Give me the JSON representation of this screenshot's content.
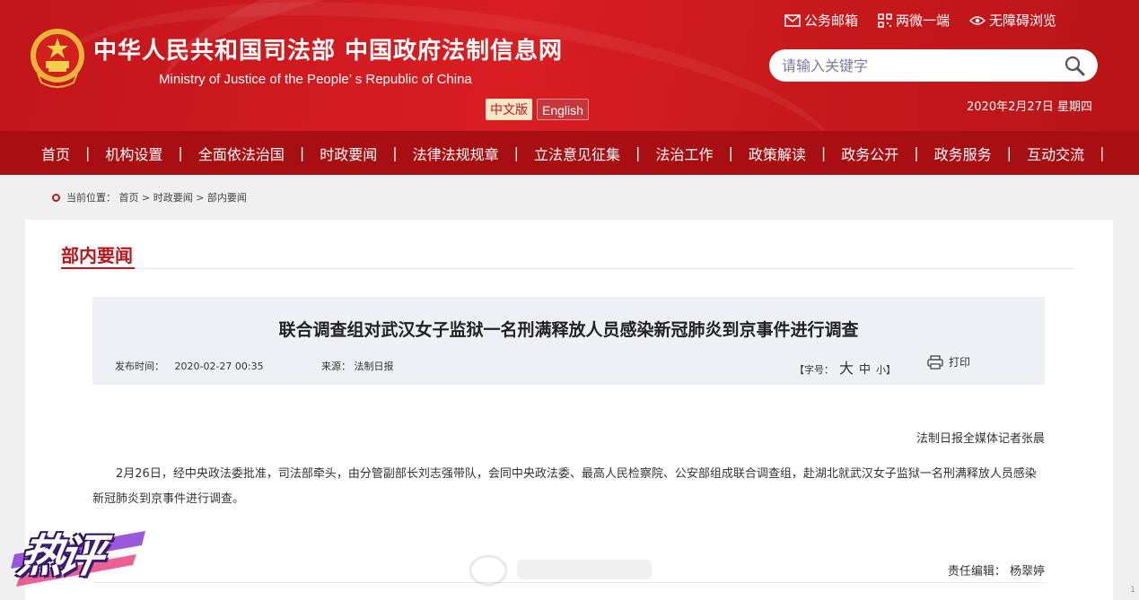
{
  "header": {
    "title": "中华人民共和国司法部  中国政府法制信息网",
    "subtitle": "Ministry of Justice of the People’ s Republic of China",
    "lang_cn": "中文版",
    "lang_en": "English",
    "links": {
      "mail": "公务邮箱",
      "wechat": "两微一端",
      "accessible": "无障碍浏览"
    },
    "search_placeholder": "请输入关键字",
    "date": "2020年2月27日 星期四"
  },
  "nav": {
    "items": [
      "首页",
      "机构设置",
      "全面依法治国",
      "时政要闻",
      "法律法规规章",
      "立法意见征集",
      "法治工作",
      "政策解读",
      "政务公开",
      "政务服务",
      "互动交流"
    ],
    "separator": "|"
  },
  "breadcrumb": "当前位置： 首页 > 时政要闻 > 部内要闻",
  "section": {
    "title": "部内要闻"
  },
  "article": {
    "title": "联合调查组对武汉女子监狱一名刑满释放人员感染新冠肺炎到京事件进行调查",
    "publish_label": "发布时间：",
    "publish_time": "2020-02-27 00:35",
    "source_label": "来源：",
    "source": "法制日报",
    "font_size_label": "【字号：",
    "font_big": "大",
    "font_mid": "中",
    "font_small": "小】",
    "print_label": "打印",
    "byline": "法制日报全媒体记者张晨",
    "body": "2月26日，经中央政法委批准，司法部牵头，由分管副部长刘志强带队，会同中央政法委、最高人民检察院、公安部组成联合调查组，赴湖北就武汉女子监狱一名刑满释放人员感染新冠肺炎到京事件进行调查。",
    "editor_label": "责任编辑：",
    "editor": "杨翠婷"
  },
  "sticker": "热评",
  "scroll_mark": "1",
  "colors": {
    "header_red": "#c1151b",
    "nav_red": "#a80f12",
    "title_red": "#b8181b"
  }
}
